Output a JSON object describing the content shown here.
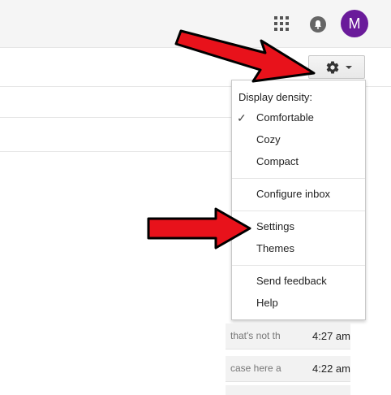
{
  "header": {
    "apps_icon": "apps-grid-icon",
    "notifications_icon": "notifications-icon",
    "avatar_letter": "M",
    "avatar_color": "#6a1b9a"
  },
  "toolbar": {
    "settings_button_icon": "gear-icon",
    "settings_button_caret": "chevron-down-icon"
  },
  "settings_menu": {
    "density_header": "Display density:",
    "density_options": [
      {
        "label": "Comfortable",
        "checked": true
      },
      {
        "label": "Cozy",
        "checked": false
      },
      {
        "label": "Compact",
        "checked": false
      }
    ],
    "check_mark": "✓",
    "configure_inbox": "Configure inbox",
    "settings": "Settings",
    "themes": "Themes",
    "send_feedback": "Send feedback",
    "help": "Help"
  },
  "email_rows": [
    {
      "snippet": "that's not th",
      "time": "4:27 am"
    },
    {
      "snippet": "case here a",
      "time": "4:22 am"
    }
  ],
  "annotation": {
    "arrow_color": "#e8121b"
  }
}
